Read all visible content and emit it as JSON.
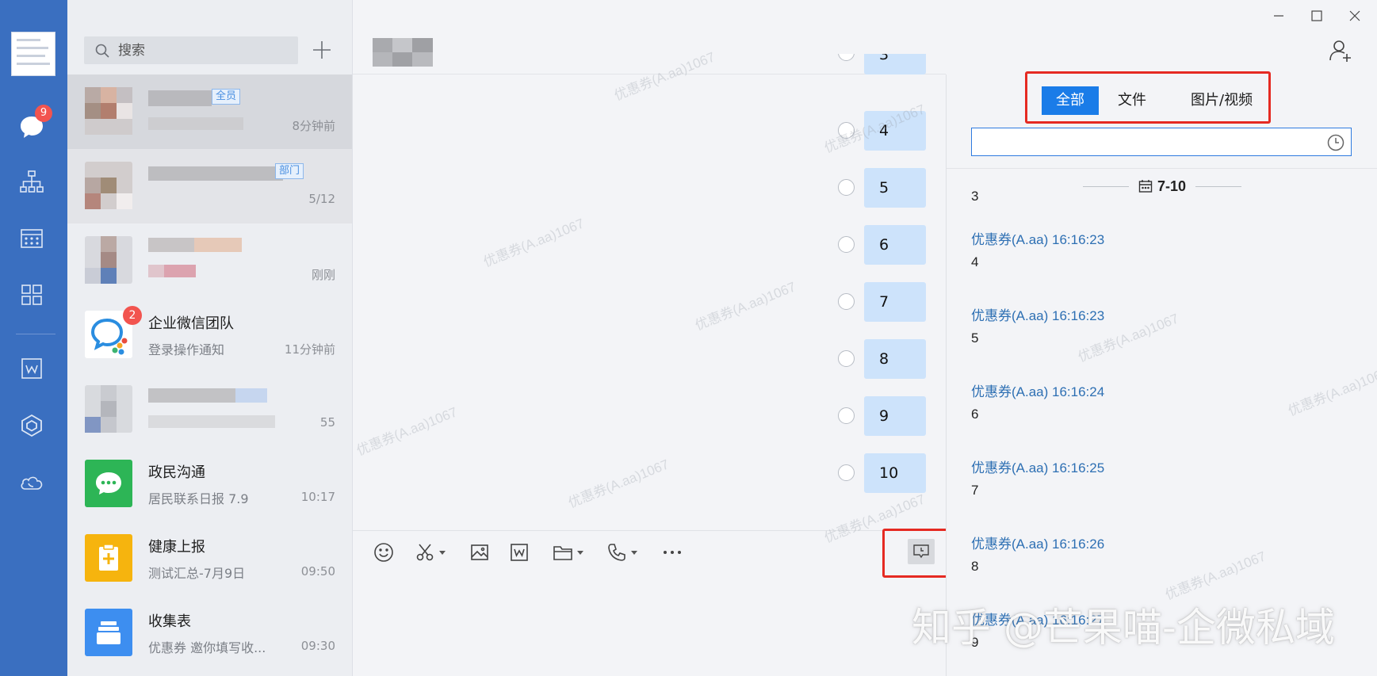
{
  "search": {
    "placeholder": "搜索"
  },
  "rail": {
    "message_badge": "9"
  },
  "conversations": [
    {
      "tag": "全员",
      "time": "8分钟前"
    },
    {
      "tag": "部门",
      "time": "5/12"
    },
    {
      "time": "刚刚"
    },
    {
      "name": "企业微信团队",
      "subtitle": "登录操作通知",
      "time": "11分钟前",
      "badge": "2"
    },
    {
      "time": "55"
    },
    {
      "name": "政民沟通",
      "subtitle": "居民联系日报 7.9",
      "time": "10:17"
    },
    {
      "name": "健康上报",
      "subtitle": "测试汇总-7月9日",
      "time": "09:50"
    },
    {
      "name": "收集表",
      "subtitle": "优惠券 邀你填写收...",
      "time": "09:30"
    }
  ],
  "chat": {
    "messages": [
      "3",
      "4",
      "5",
      "6",
      "7",
      "8",
      "9",
      "10"
    ]
  },
  "history": {
    "tabs": [
      "全部",
      "文件",
      "图片/视频"
    ],
    "active_tab": "全部",
    "search_value": "",
    "date": "7-10",
    "first_text": "3",
    "entries": [
      {
        "sender": "优惠券(A.aa) 16:16:23",
        "text": "4"
      },
      {
        "sender": "优惠券(A.aa) 16:16:23",
        "text": "5"
      },
      {
        "sender": "优惠券(A.aa) 16:16:24",
        "text": "6"
      },
      {
        "sender": "优惠券(A.aa) 16:16:25",
        "text": "7"
      },
      {
        "sender": "优惠券(A.aa) 16:16:26",
        "text": "8"
      },
      {
        "sender": "优惠券(A.aa) 16:16:27",
        "text": "9"
      }
    ]
  },
  "watermark": {
    "text": "优惠券(A.aa)1067",
    "bottom_banner": "知乎 @芒果喵-企微私域"
  },
  "colors": {
    "rail_blue": "#3a6fc0",
    "accent": "#1a7ce8",
    "bubble": "#cde3fb",
    "badge_red": "#f2544f",
    "highlight_red": "#e52a22",
    "sender_blue": "#2d6fb3"
  }
}
